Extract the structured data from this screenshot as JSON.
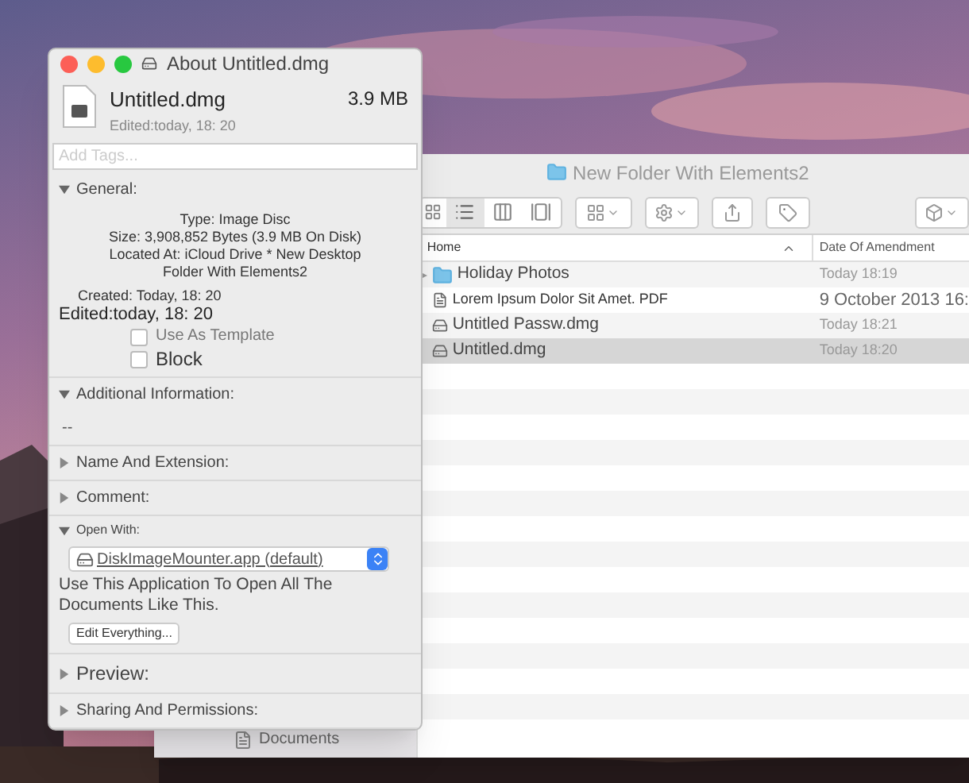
{
  "info_window": {
    "title": "About Untitled.dmg",
    "file": {
      "name": "Untitled.dmg",
      "size": "3.9 MB",
      "edited": "Edited:today, 18: 20"
    },
    "tags": {
      "placeholder": "Add Tags..."
    },
    "sections": [
      {
        "kind": "general",
        "title": "General:",
        "expanded": true,
        "details": [
          "Type: Image Disc",
          "Size: 3,908,852 Bytes (3.9 MB On Disk)",
          "Located At: iCloud Drive * New Desktop",
          "Folder With Elements2"
        ],
        "created": "Created: Today, 18: 20",
        "modified": "Edited:today, 18: 20",
        "options": [
          {
            "label": "Use As Template",
            "checked": false
          },
          {
            "label": "Block",
            "checked": false
          }
        ]
      },
      {
        "kind": "info",
        "title": "Additional Information:",
        "expanded": true,
        "text": "--"
      },
      {
        "kind": "plain",
        "title": "Name And Extension:",
        "expanded": false
      },
      {
        "kind": "plain",
        "title": "Comment:",
        "expanded": false
      },
      {
        "kind": "open_with",
        "title": "Open With:",
        "expanded": true,
        "app": "DiskImageMounter.app (default)",
        "note": "Use This Application To Open All The Documents Like This.",
        "button": "Edit Everything..."
      },
      {
        "kind": "plain",
        "title": "Preview:",
        "expanded": false
      },
      {
        "kind": "plain",
        "title": "Sharing And Permissions:",
        "expanded": false
      }
    ]
  },
  "finder_window": {
    "title": "New Folder With Elements2",
    "sidebar": [
      {
        "label": "Documents"
      }
    ],
    "columns": [
      "Home",
      "Date Of Amendment"
    ],
    "rows": [
      {
        "kind": "folder",
        "name": "Holiday Photos",
        "date": "Today 18:19",
        "selected": false
      },
      {
        "kind": "pdf",
        "name": "Lorem Ipsum Dolor Sit Amet. PDF",
        "date": "9 October 2013 16:",
        "selected": false
      },
      {
        "kind": "dmg",
        "name": "Untitled Passw.dmg",
        "date": "Today 18:21",
        "selected": false
      },
      {
        "kind": "dmg",
        "name": "Untitled.dmg",
        "date": "Today 18:20",
        "selected": true
      }
    ]
  }
}
